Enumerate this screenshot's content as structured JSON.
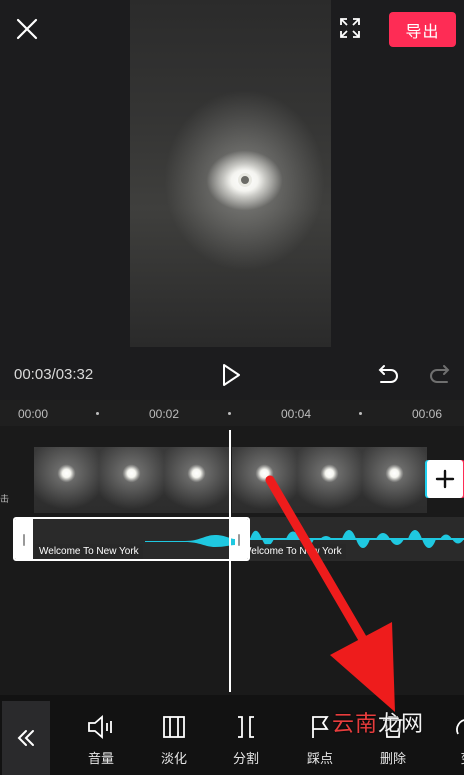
{
  "header": {
    "export_label": "导出",
    "close_icon": "close-icon",
    "fullscreen_icon": "fullscreen-icon"
  },
  "player": {
    "current_time": "00:03",
    "total_time": "03:32",
    "timecode": "00:03/03:32",
    "play_icon": "play-icon",
    "undo_icon": "undo-icon",
    "redo_icon": "redo-icon"
  },
  "ruler": {
    "ticks": [
      "00:00",
      "00:02",
      "00:04",
      "00:06"
    ]
  },
  "tracks": {
    "side_label": "击",
    "audio_clip_1": "Welcome To New York",
    "audio_clip_2": "Welcome To New York",
    "add_icon": "plus-icon"
  },
  "toolbar": {
    "back_icon": "double-chevron-left-icon",
    "items": [
      {
        "label": "音量",
        "icon": "volume-icon"
      },
      {
        "label": "淡化",
        "icon": "fade-icon"
      },
      {
        "label": "分割",
        "icon": "split-icon"
      },
      {
        "label": "踩点",
        "icon": "beat-flag-icon"
      },
      {
        "label": "删除",
        "icon": "delete-icon"
      },
      {
        "label": "变",
        "icon": "speed-icon"
      }
    ]
  },
  "watermark": {
    "part1": "云南",
    "part2": "龙网"
  },
  "colors": {
    "accent": "#fe2c55",
    "waveform": "#1fc8e0",
    "annotation_arrow": "#ee1c1c"
  }
}
